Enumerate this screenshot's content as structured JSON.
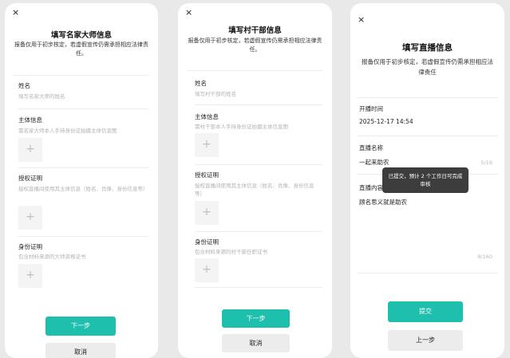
{
  "colors": {
    "accent": "#1fbfae",
    "background": "#e9e9e9",
    "placeholder": "#b3b3b3"
  },
  "icons": {
    "close": "close-icon",
    "upload": "plus-icon"
  },
  "screen1": {
    "close_glyph": "×",
    "title": "填写名家大师信息",
    "notice": "报备仅用于初步核定，若虚假宣传仍需承担相应法律责任。",
    "name_label": "姓名",
    "name_placeholder": "填写名家大师的姓名",
    "subject_label": "主体信息",
    "subject_hint": "需名家大师本人手持身份证拍摄主体信息图",
    "auth_label": "授权证明",
    "auth_hint": "授权直播间使用其主体信息（姓名、肖像、身份信息等）",
    "id_label": "身份证明",
    "id_hint": "包含材料来源的大师资格证书",
    "upload_glyph": "+",
    "next_button": "下一步",
    "cancel_button": "取消"
  },
  "screen2": {
    "title": "填写村干部信息",
    "notice": "报备仅用于初步核定，若虚假宣传仍需承担相应法律责任。",
    "name_label": "姓名",
    "name_placeholder": "填写村干部的姓名",
    "subject_label": "主体信息",
    "subject_hint": "需村干部本人手持身份证拍摄主体信息图",
    "auth_label": "授权证明",
    "auth_hint": "授权直播间使用其主体信息（姓名、肖像、身份信息等）",
    "id_label": "身份证明",
    "id_hint": "包含材料来源的村干部任职证书",
    "upload_glyph": "+",
    "next_button": "下一步",
    "cancel_button": "取消"
  },
  "screen3": {
    "close_glyph": "×",
    "title": "填写直播信息",
    "notice": "报备仅用于初步核定，若虚假宣传仍需承担相应法律责任",
    "time_label": "开播时间",
    "time_value": "2025-12-17 14:54",
    "live_name_label": "直播名称",
    "live_name_value": "一起来助农",
    "live_name_counter": "5/16",
    "content_label": "直播内容",
    "content_value": "顾名思义就是助农",
    "content_counter": "8/160",
    "toast": "已提交，预计 2 个工作日可完成审核",
    "submit_button": "提交",
    "prev_button": "上一步"
  }
}
